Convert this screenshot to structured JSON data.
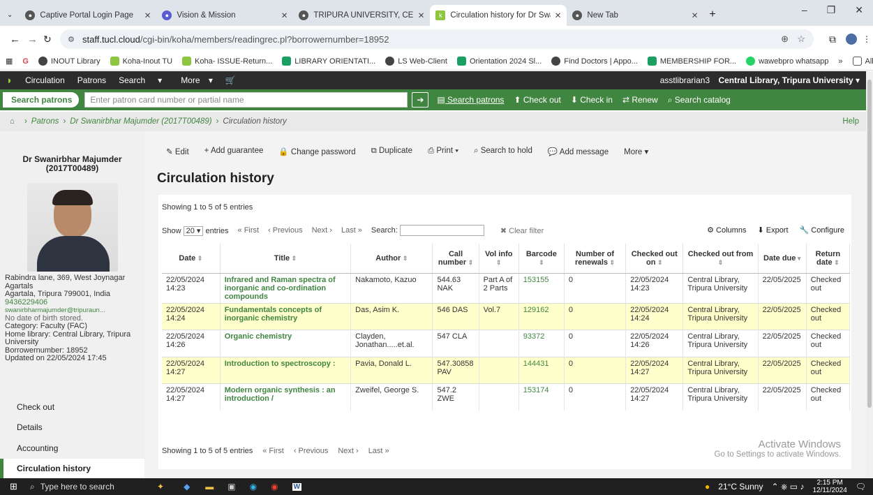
{
  "browser": {
    "tabs": [
      {
        "label": "Captive Portal Login Page",
        "color": "#555"
      },
      {
        "label": "Vision & Mission",
        "color": "#5a5ad2"
      },
      {
        "label": "TRIPURA UNIVERSITY, CENTRAL",
        "color": "#555"
      },
      {
        "label": "Circulation history for Dr Swani",
        "color": "#8dc63f",
        "active": true
      },
      {
        "label": "New Tab",
        "color": "#555"
      }
    ],
    "url_host": "staff.tucl.cloud",
    "url_path": "/cgi-bin/koha/members/readingrec.pl?borrowernumber=18952",
    "bookmarks": [
      "INOUT Library",
      "Koha-Inout TU",
      "Koha- ISSUE-Return...",
      "LIBRARY ORIENTATI...",
      "LS Web-Client",
      "Orientation 2024 Sl...",
      "Find Doctors | Appo...",
      "MEMBERSHIP FOR...",
      "wawebpro whatsapp"
    ],
    "all_bookmarks": "All Bookmarks"
  },
  "nav": {
    "items": [
      "Circulation",
      "Patrons",
      "Search",
      "More"
    ],
    "user": "asstlibrarian3",
    "branch": "Central Library, Tripura University"
  },
  "search": {
    "tab": "Search patrons",
    "placeholder": "Enter patron card number or partial name",
    "links": [
      "Search patrons",
      "Check out",
      "Check in",
      "Renew",
      "Search catalog"
    ]
  },
  "breadcrumb": {
    "patrons": "Patrons",
    "patron": "Dr Swanirbhar Majumder (2017T00489)",
    "current": "Circulation history",
    "help": "Help"
  },
  "patron": {
    "name": "Dr Swanirbhar Majumder",
    "card": "(2017T00489)",
    "address1": "Rabindra lane, 369, West Joynagar",
    "address2": "Agartals",
    "city": "Agartala, Tripura 799001, India",
    "phone": "9436229406",
    "email": "swanirbharmajumder@tripuraun...",
    "dob": "No date of birth stored.",
    "category": "Category: Faculty (FAC)",
    "library": "Home library: Central Library, Tripura University",
    "borrower": "Borrowernumber: 18952",
    "updated": "Updated on 22/05/2024 17:45"
  },
  "sidebar": [
    "Check out",
    "Details",
    "Accounting",
    "Circulation history"
  ],
  "toolbar": [
    "Edit",
    "Add guarantee",
    "Change password",
    "Duplicate",
    "Print",
    "Search to hold",
    "Add message",
    "More"
  ],
  "page_title": "Circulation history",
  "table": {
    "showing": "Showing 1 to 5 of 5 entries",
    "show": "Show",
    "per_page": "20",
    "entries": "entries",
    "first": "« First",
    "prev": "‹ Previous",
    "next": "Next ›",
    "last": "Last »",
    "search": "Search:",
    "clear": "Clear filter",
    "columns": "Columns",
    "export": "Export",
    "configure": "Configure",
    "headers": [
      "Date",
      "Title",
      "Author",
      "Call number",
      "Vol info",
      "Barcode",
      "Number of renewals",
      "Checked out on",
      "Checked out from",
      "Date due",
      "Return date"
    ],
    "rows": [
      [
        "22/05/2024 14:23",
        "Infrared and Raman spectra of inorganic and co-ordination compounds",
        "Nakamoto, Kazuo",
        "544.63 NAK",
        "Part A of 2 Parts",
        "153155",
        "0",
        "22/05/2024 14:23",
        "Central Library, Tripura University",
        "22/05/2025",
        "Checked out"
      ],
      [
        "22/05/2024 14:24",
        "Fundamentals concepts of inorganic chemistry",
        "Das, Asim K.",
        "546 DAS",
        "Vol.7",
        "129162",
        "0",
        "22/05/2024 14:24",
        "Central Library, Tripura University",
        "22/05/2025",
        "Checked out"
      ],
      [
        "22/05/2024 14:26",
        "Organic chemistry",
        "Clayden, Jonathan.....et.al.",
        "547 CLA",
        "",
        "93372",
        "0",
        "22/05/2024 14:26",
        "Central Library, Tripura University",
        "22/05/2025",
        "Checked out"
      ],
      [
        "22/05/2024 14:27",
        "Introduction to spectroscopy :",
        "Pavia, Donald L.",
        "547.30858 PAV",
        "",
        "144431",
        "0",
        "22/05/2024 14:27",
        "Central Library, Tripura University",
        "22/05/2025",
        "Checked out"
      ],
      [
        "22/05/2024 14:27",
        "Modern organic synthesis : an introduction /",
        "Zweifel, George S.",
        "547.2 ZWE",
        "",
        "153174",
        "0",
        "22/05/2024 14:27",
        "Central Library, Tripura University",
        "22/05/2025",
        "Checked out"
      ]
    ]
  },
  "watermark": {
    "title": "Activate Windows",
    "sub": "Go to Settings to activate Windows."
  },
  "taskbar": {
    "search": "Type here to search",
    "weather": "21°C  Sunny",
    "time": "2:15 PM",
    "date": "12/11/2024"
  },
  "colors": {
    "accent": "#408540",
    "nav": "#2c2c2c",
    "highlight": "#ffffcc"
  }
}
